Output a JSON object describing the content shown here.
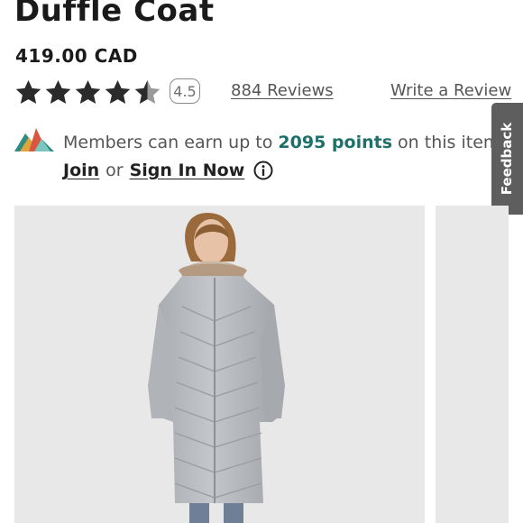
{
  "product": {
    "title": "Duffle Coat",
    "price": "419.00 CAD",
    "rating": 4.5,
    "rating_label": "4.5",
    "reviews_label": "884 Reviews",
    "write_review_label": "Write a Review"
  },
  "rewards": {
    "message_before": "Members can earn up to ",
    "points": "2095 points",
    "message_after": " on this item",
    "join_label": "Join",
    "or_label": "or",
    "sign_in_label": "Sign In Now",
    "info_icon": "info-icon"
  },
  "feedback": {
    "label": "Feedback"
  },
  "gallery": {
    "main_image_icon": "model-wearing-long-grey-down-parka",
    "next_image_icon": "next-gallery-image"
  },
  "colors": {
    "star_filled": "#2b2b2b",
    "star_empty": "#9a9a9a",
    "points_accent": "#1f6f6a",
    "image_background": "#e8e8e8",
    "feedback_tab": "#5e5e5e"
  }
}
